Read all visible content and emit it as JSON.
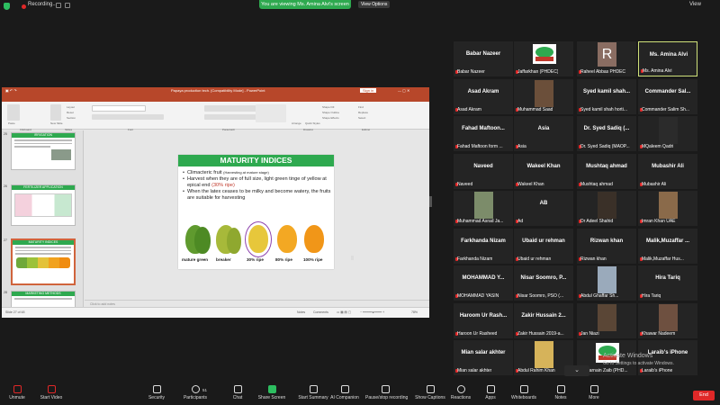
{
  "topbar": {
    "recording": "Recording...",
    "viewing": "You are viewing Ms. Amina Alvi's screen",
    "view_options": "View Options",
    "view": "View"
  },
  "ppt": {
    "title": "Papaya production tech. [Compatibility Mode] - PowerPoint",
    "signin": "Sign in",
    "tabs": [
      "File",
      "Home",
      "Insert",
      "Design",
      "Transitions",
      "Animations",
      "Slide Show",
      "Review",
      "View",
      "Help",
      "Tell me what you want to do"
    ],
    "active_tab": "Home",
    "ribbon_groups": [
      "Clipboard",
      "Slides",
      "Font",
      "Paragraph",
      "Drawing",
      "Editing"
    ],
    "ribbon_buttons": [
      "Paste",
      "New Slide",
      "Reuse Slides",
      "Layout",
      "Reset",
      "Section",
      "Arrange",
      "Quick Styles",
      "Shape Fill",
      "Shape Outline",
      "Shape Effects",
      "Find",
      "Replace",
      "Select"
    ],
    "thumbnails": [
      {
        "num": "25",
        "title": "IRRIGATION"
      },
      {
        "num": "26",
        "title": "FERTILIZER APPLICATION"
      },
      {
        "num": "27",
        "title": "MATURITY INDICES"
      },
      {
        "num": "28",
        "title": "MARKETING METHODS"
      }
    ],
    "slide": {
      "title": "MATURITY INDICES",
      "b1": "Climacteric fruit",
      "b1_note": "(Harvesting at mature stage)",
      "b2a": "Harvest when they are  of full size, light green tinge of yellow at epical end",
      "b2b": "(30% ripe)",
      "b3": "When the latex ceases to be milky and become watery, the fruits are suitable for harvesting",
      "stages": [
        "mature green",
        "breaker",
        "30% ripe",
        "80% ripe",
        "100% ripe"
      ]
    },
    "notes": "Click to add notes",
    "status": {
      "slide": "Slide 27 of 48",
      "notes": "Notes",
      "comments": "Comments",
      "zoom": "78%"
    }
  },
  "participants": [
    {
      "name": "Babar Nazeer",
      "sub": "Babar Nazeer",
      "type": "name"
    },
    {
      "name": "",
      "sub": "Jaffarkhan (PHDEC)",
      "type": "logo"
    },
    {
      "name": "",
      "sub": "Raheel Abbas PHDEC",
      "type": "avatar",
      "letter": "R"
    },
    {
      "name": "Ms. Amina Alvi",
      "sub": "Ms. Amina Alvi",
      "type": "name",
      "active": true
    },
    {
      "name": "Asad Akram",
      "sub": "Asad Akram",
      "type": "name"
    },
    {
      "name": "",
      "sub": "Muhammad Saad",
      "type": "photo",
      "color": "#6b4f3a"
    },
    {
      "name": "Syed kamil shah...",
      "sub": "Syed kamil shah horti...",
      "type": "name"
    },
    {
      "name": "Commander Sal...",
      "sub": "Commander Salim Sh...",
      "type": "name"
    },
    {
      "name": "Fahad Maftoon...",
      "sub": "Fahad Maftoon form ...",
      "type": "name"
    },
    {
      "name": "Asia",
      "sub": "Asia",
      "type": "name"
    },
    {
      "name": "Dr. Syed Sadiq (...",
      "sub": "Dr. Syed Sadiq (MAOP...",
      "type": "name"
    },
    {
      "name": "",
      "sub": "MQaleem Qadri",
      "type": "photo",
      "color": "#2b2b2b"
    },
    {
      "name": "Naveed",
      "sub": "Naveed",
      "type": "name"
    },
    {
      "name": "Wakeel Khan",
      "sub": "Wakeel Khan",
      "type": "name"
    },
    {
      "name": "Mushtaq ahmad",
      "sub": "Mushtaq ahmad",
      "type": "name"
    },
    {
      "name": "Mubashir Ali",
      "sub": "Mubashir Ali",
      "type": "name"
    },
    {
      "name": "",
      "sub": "Muhammad Asrad Ja...",
      "type": "photo",
      "color": "#7c8c6a"
    },
    {
      "name": "AB",
      "sub": "Ad",
      "type": "name"
    },
    {
      "name": "",
      "sub": "Dr Adeel Shahid",
      "type": "photo",
      "color": "#3a3028"
    },
    {
      "name": "",
      "sub": "Imran Khan UAE",
      "type": "photo",
      "color": "#8a6a4a"
    },
    {
      "name": "Farkhanda Nizam",
      "sub": "Farkhanda Nizam",
      "type": "name"
    },
    {
      "name": "Ubaid ur rehman",
      "sub": "Ubaid ur rehman",
      "type": "name"
    },
    {
      "name": "Rizwan khan",
      "sub": "Rizwan khan",
      "type": "name"
    },
    {
      "name": "Malik,Muzaffar ...",
      "sub": "Malik,Muzaffar Hus...",
      "type": "name"
    },
    {
      "name": "MOHAMMAD Y...",
      "sub": "MOHAMMAD YASIN",
      "type": "name"
    },
    {
      "name": "Nisar Soomro, P...",
      "sub": "Nisar Soomro, PSO (...",
      "type": "name"
    },
    {
      "name": "",
      "sub": "Abdul Ghaffar Sh...",
      "type": "photo",
      "color": "#9aaabb"
    },
    {
      "name": "Hira Tariq",
      "sub": "Hira Tariq",
      "type": "name"
    },
    {
      "name": "Haroom Ur Rash...",
      "sub": "Haroon Ur Rasheed",
      "type": "name"
    },
    {
      "name": "Zakir Hussain 2...",
      "sub": "Zakir Hussain 2019-a...",
      "type": "name"
    },
    {
      "name": "",
      "sub": "Jan Niazi",
      "type": "photo",
      "color": "#5a4636"
    },
    {
      "name": "",
      "sub": "Khawar Nadeem",
      "type": "photo",
      "color": "#6e5040"
    },
    {
      "name": "Mian salar akhter",
      "sub": "Mian salar akhter",
      "type": "name"
    },
    {
      "name": "",
      "sub": "Abdul Rahim Khan",
      "type": "photo",
      "color": "#d6b35a"
    },
    {
      "name": "",
      "sub": "Zulqarnain Zaib (PHD...",
      "type": "logo"
    },
    {
      "name": "Laraib's iPhone",
      "sub": "Laraib's iPhone",
      "type": "name"
    }
  ],
  "windows": {
    "title": "Activate Windows",
    "sub": "Go to Settings to activate Windows."
  },
  "bottombar": [
    {
      "label": "Unmute",
      "name": "unmute-button"
    },
    {
      "label": "Start Video",
      "name": "start-video-button"
    },
    {
      "label": "Security",
      "name": "security-button"
    },
    {
      "label": "Participants",
      "name": "participants-button",
      "count": "51"
    },
    {
      "label": "Chat",
      "name": "chat-button"
    },
    {
      "label": "Share Screen",
      "name": "share-screen-button"
    },
    {
      "label": "Start Summary",
      "name": "start-summary-button"
    },
    {
      "label": "AI Companion",
      "name": "ai-companion-button"
    },
    {
      "label": "Pause/stop recording",
      "name": "pause-stop-recording-button"
    },
    {
      "label": "Show Captions",
      "name": "show-captions-button"
    },
    {
      "label": "Reactions",
      "name": "reactions-button"
    },
    {
      "label": "Apps",
      "name": "apps-button"
    },
    {
      "label": "Whiteboards",
      "name": "whiteboards-button"
    },
    {
      "label": "Notes",
      "name": "notes-button"
    },
    {
      "label": "More",
      "name": "more-button"
    }
  ],
  "end_label": "End",
  "colors": {
    "slide_header": "#2ea94f",
    "ppt_brand": "#b7472a",
    "share_green": "#2dbe60",
    "end_red": "#e02828"
  }
}
